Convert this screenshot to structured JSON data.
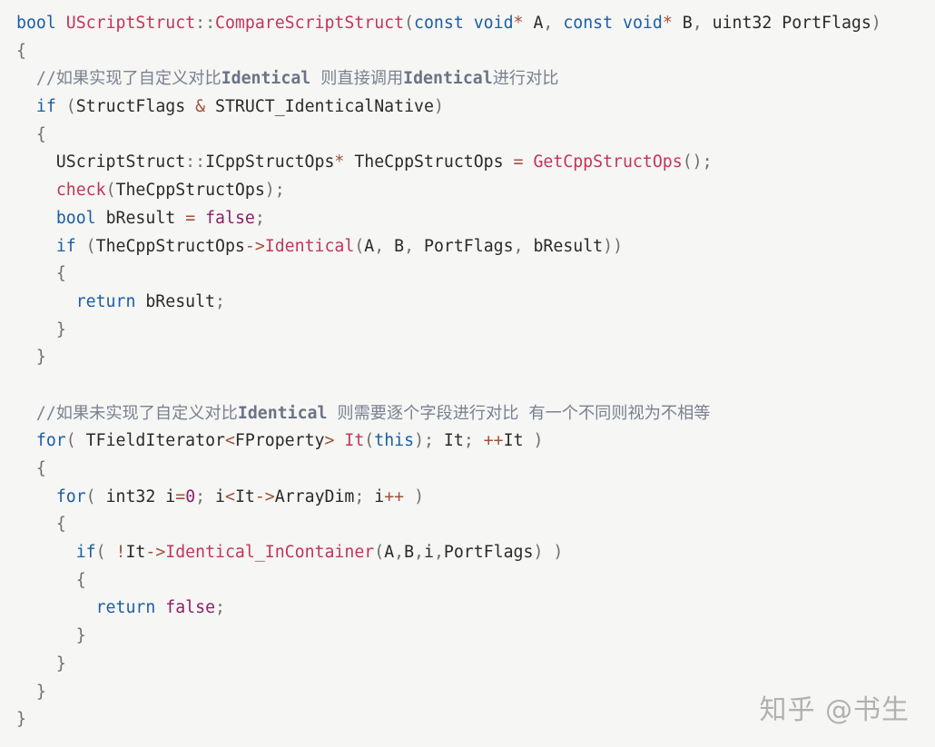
{
  "colors": {
    "background": "#f6f6f4",
    "keyword": "#1b5ea8",
    "function": "#c0365b",
    "constant": "#8a1f6a",
    "operator": "#a0523a",
    "punctuation": "#6f6f6f",
    "identifier": "#2a2a2a",
    "comment": "#7a8191"
  },
  "code": [
    [
      {
        "t": "bool",
        "c": "kw"
      },
      {
        "t": " ",
        "c": "ident"
      },
      {
        "t": "UScriptStruct",
        "c": "fn"
      },
      {
        "t": "::",
        "c": "punc"
      },
      {
        "t": "CompareScriptStruct",
        "c": "fn"
      },
      {
        "t": "(",
        "c": "punc"
      },
      {
        "t": "const",
        "c": "kw"
      },
      {
        "t": " ",
        "c": "ident"
      },
      {
        "t": "void",
        "c": "kw"
      },
      {
        "t": "*",
        "c": "op"
      },
      {
        "t": " A",
        "c": "ident"
      },
      {
        "t": ",",
        "c": "punc"
      },
      {
        "t": " ",
        "c": "ident"
      },
      {
        "t": "const",
        "c": "kw"
      },
      {
        "t": " ",
        "c": "ident"
      },
      {
        "t": "void",
        "c": "kw"
      },
      {
        "t": "*",
        "c": "op"
      },
      {
        "t": " B",
        "c": "ident"
      },
      {
        "t": ",",
        "c": "punc"
      },
      {
        "t": " uint32 PortFlags",
        "c": "ident"
      },
      {
        "t": ")",
        "c": "punc"
      }
    ],
    [
      {
        "t": "{",
        "c": "punc"
      }
    ],
    [
      {
        "t": "  ",
        "c": "ident"
      },
      {
        "t": "//如果实现了自定义对比",
        "c": "comment"
      },
      {
        "t": "Identical",
        "c": "comment-strong"
      },
      {
        "t": " 则直接调用",
        "c": "comment"
      },
      {
        "t": "Identical",
        "c": "comment-strong"
      },
      {
        "t": "进行对比",
        "c": "comment"
      }
    ],
    [
      {
        "t": "  ",
        "c": "ident"
      },
      {
        "t": "if",
        "c": "kw"
      },
      {
        "t": " ",
        "c": "ident"
      },
      {
        "t": "(",
        "c": "punc"
      },
      {
        "t": "StructFlags ",
        "c": "ident"
      },
      {
        "t": "&",
        "c": "op"
      },
      {
        "t": " STRUCT_IdenticalNative",
        "c": "ident"
      },
      {
        "t": ")",
        "c": "punc"
      }
    ],
    [
      {
        "t": "  ",
        "c": "ident"
      },
      {
        "t": "{",
        "c": "punc"
      }
    ],
    [
      {
        "t": "    UScriptStruct",
        "c": "ident"
      },
      {
        "t": "::",
        "c": "punc"
      },
      {
        "t": "ICppStructOps",
        "c": "ident"
      },
      {
        "t": "*",
        "c": "op"
      },
      {
        "t": " TheCppStructOps ",
        "c": "ident"
      },
      {
        "t": "=",
        "c": "op"
      },
      {
        "t": " ",
        "c": "ident"
      },
      {
        "t": "GetCppStructOps",
        "c": "fn"
      },
      {
        "t": "();",
        "c": "punc"
      }
    ],
    [
      {
        "t": "    ",
        "c": "ident"
      },
      {
        "t": "check",
        "c": "fn"
      },
      {
        "t": "(",
        "c": "punc"
      },
      {
        "t": "TheCppStructOps",
        "c": "ident"
      },
      {
        "t": ");",
        "c": "punc"
      }
    ],
    [
      {
        "t": "    ",
        "c": "ident"
      },
      {
        "t": "bool",
        "c": "kw"
      },
      {
        "t": " bResult ",
        "c": "ident"
      },
      {
        "t": "=",
        "c": "op"
      },
      {
        "t": " ",
        "c": "ident"
      },
      {
        "t": "false",
        "c": "const"
      },
      {
        "t": ";",
        "c": "punc"
      }
    ],
    [
      {
        "t": "    ",
        "c": "ident"
      },
      {
        "t": "if",
        "c": "kw"
      },
      {
        "t": " ",
        "c": "ident"
      },
      {
        "t": "(",
        "c": "punc"
      },
      {
        "t": "TheCppStructOps",
        "c": "ident"
      },
      {
        "t": "->",
        "c": "op"
      },
      {
        "t": "Identical",
        "c": "fn"
      },
      {
        "t": "(",
        "c": "punc"
      },
      {
        "t": "A",
        "c": "ident"
      },
      {
        "t": ",",
        "c": "punc"
      },
      {
        "t": " B",
        "c": "ident"
      },
      {
        "t": ",",
        "c": "punc"
      },
      {
        "t": " PortFlags",
        "c": "ident"
      },
      {
        "t": ",",
        "c": "punc"
      },
      {
        "t": " bResult",
        "c": "ident"
      },
      {
        "t": "))",
        "c": "punc"
      }
    ],
    [
      {
        "t": "    ",
        "c": "ident"
      },
      {
        "t": "{",
        "c": "punc"
      }
    ],
    [
      {
        "t": "      ",
        "c": "ident"
      },
      {
        "t": "return",
        "c": "kw"
      },
      {
        "t": " bResult",
        "c": "ident"
      },
      {
        "t": ";",
        "c": "punc"
      }
    ],
    [
      {
        "t": "    ",
        "c": "ident"
      },
      {
        "t": "}",
        "c": "punc"
      }
    ],
    [
      {
        "t": "  ",
        "c": "ident"
      },
      {
        "t": "}",
        "c": "punc"
      }
    ],
    [
      {
        "t": "",
        "c": "ident"
      }
    ],
    [
      {
        "t": "  ",
        "c": "ident"
      },
      {
        "t": "//如果未实现了自定义对比",
        "c": "comment"
      },
      {
        "t": "Identical",
        "c": "comment-strong"
      },
      {
        "t": " 则需要逐个字段进行对比 有一个不同则视为不相等",
        "c": "comment"
      }
    ],
    [
      {
        "t": "  ",
        "c": "ident"
      },
      {
        "t": "for",
        "c": "kw"
      },
      {
        "t": "(",
        "c": "punc"
      },
      {
        "t": " TFieldIterator",
        "c": "ident"
      },
      {
        "t": "<",
        "c": "op"
      },
      {
        "t": "FProperty",
        "c": "ident"
      },
      {
        "t": ">",
        "c": "op"
      },
      {
        "t": " ",
        "c": "ident"
      },
      {
        "t": "It",
        "c": "fn"
      },
      {
        "t": "(",
        "c": "punc"
      },
      {
        "t": "this",
        "c": "kw"
      },
      {
        "t": ");",
        "c": "punc"
      },
      {
        "t": " It",
        "c": "ident"
      },
      {
        "t": ";",
        "c": "punc"
      },
      {
        "t": " ",
        "c": "ident"
      },
      {
        "t": "++",
        "c": "op"
      },
      {
        "t": "It ",
        "c": "ident"
      },
      {
        "t": ")",
        "c": "punc"
      }
    ],
    [
      {
        "t": "  ",
        "c": "ident"
      },
      {
        "t": "{",
        "c": "punc"
      }
    ],
    [
      {
        "t": "    ",
        "c": "ident"
      },
      {
        "t": "for",
        "c": "kw"
      },
      {
        "t": "(",
        "c": "punc"
      },
      {
        "t": " int32 i",
        "c": "ident"
      },
      {
        "t": "=",
        "c": "op"
      },
      {
        "t": "0",
        "c": "num"
      },
      {
        "t": ";",
        "c": "punc"
      },
      {
        "t": " i",
        "c": "ident"
      },
      {
        "t": "<",
        "c": "op"
      },
      {
        "t": "It",
        "c": "ident"
      },
      {
        "t": "->",
        "c": "op"
      },
      {
        "t": "ArrayDim",
        "c": "ident"
      },
      {
        "t": ";",
        "c": "punc"
      },
      {
        "t": " i",
        "c": "ident"
      },
      {
        "t": "++",
        "c": "op"
      },
      {
        "t": " ",
        "c": "ident"
      },
      {
        "t": ")",
        "c": "punc"
      }
    ],
    [
      {
        "t": "    ",
        "c": "ident"
      },
      {
        "t": "{",
        "c": "punc"
      }
    ],
    [
      {
        "t": "      ",
        "c": "ident"
      },
      {
        "t": "if",
        "c": "kw"
      },
      {
        "t": "(",
        "c": "punc"
      },
      {
        "t": " ",
        "c": "ident"
      },
      {
        "t": "!",
        "c": "op"
      },
      {
        "t": "It",
        "c": "ident"
      },
      {
        "t": "->",
        "c": "op"
      },
      {
        "t": "Identical_InContainer",
        "c": "fn"
      },
      {
        "t": "(",
        "c": "punc"
      },
      {
        "t": "A",
        "c": "ident"
      },
      {
        "t": ",",
        "c": "punc"
      },
      {
        "t": "B",
        "c": "ident"
      },
      {
        "t": ",",
        "c": "punc"
      },
      {
        "t": "i",
        "c": "ident"
      },
      {
        "t": ",",
        "c": "punc"
      },
      {
        "t": "PortFlags",
        "c": "ident"
      },
      {
        "t": ")",
        "c": "punc"
      },
      {
        "t": " ",
        "c": "ident"
      },
      {
        "t": ")",
        "c": "punc"
      }
    ],
    [
      {
        "t": "      ",
        "c": "ident"
      },
      {
        "t": "{",
        "c": "punc"
      }
    ],
    [
      {
        "t": "        ",
        "c": "ident"
      },
      {
        "t": "return",
        "c": "kw"
      },
      {
        "t": " ",
        "c": "ident"
      },
      {
        "t": "false",
        "c": "const"
      },
      {
        "t": ";",
        "c": "punc"
      }
    ],
    [
      {
        "t": "      ",
        "c": "ident"
      },
      {
        "t": "}",
        "c": "punc"
      }
    ],
    [
      {
        "t": "    ",
        "c": "ident"
      },
      {
        "t": "}",
        "c": "punc"
      }
    ],
    [
      {
        "t": "  ",
        "c": "ident"
      },
      {
        "t": "}",
        "c": "punc"
      }
    ],
    [
      {
        "t": "}",
        "c": "punc"
      }
    ]
  ],
  "watermark": "知乎 @书生"
}
